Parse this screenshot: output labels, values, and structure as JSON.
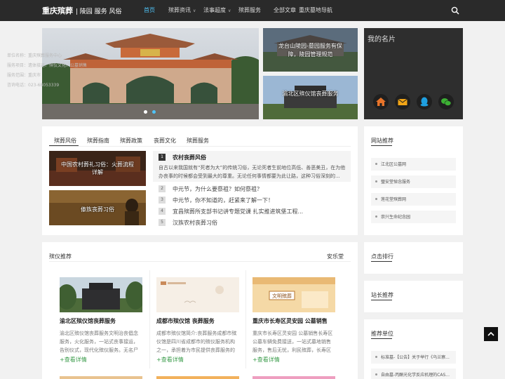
{
  "header": {
    "logo": "重庆殡葬",
    "logo_sub": "| 陵园 服务 风俗",
    "nav": [
      {
        "label": "首页",
        "active": true,
        "caret": false
      },
      {
        "label": "殡葬资讯",
        "active": false,
        "caret": true
      },
      {
        "label": "法事超度",
        "active": false,
        "caret": true
      },
      {
        "label": "殡葬服务",
        "active": false,
        "caret": false
      },
      {
        "label": "全部文章",
        "active": false,
        "caret": false
      },
      {
        "label": "重庆墓地导航",
        "active": false,
        "caret": false
      }
    ],
    "search_icon": "search-icon"
  },
  "banner": {
    "thumbs": [
      {
        "caption_line1": "龙台山陵园-墓园服务有保",
        "caption_line2": "障，陵园管理规范"
      },
      {
        "caption_line1": "渝北区殡仪馆丧葬服务",
        "caption_line2": ""
      }
    ]
  },
  "namecard": {
    "title": "我的名片",
    "lines": [
      "单位名称：重庆殡葬服务中心",
      "服务项目：遗体接运、殡仪文化、公墓销售",
      "服务范围：重庆市",
      "咨询电话：023-68053339"
    ],
    "icons": [
      "home-icon",
      "mail-icon",
      "qq-icon",
      "wechat-icon"
    ],
    "colors": {
      "home": "#e8742a",
      "mail": "#f2a516",
      "qq": "#1e9fe0",
      "wechat": "#3cb034"
    }
  },
  "news": {
    "tabs": [
      "殡葬风俗",
      "殡葬指南",
      "殡葬政策",
      "丧葬文化",
      "殡葬服务"
    ],
    "images": [
      {
        "caption_line1": "中国农村葬礼习俗：火葬流程",
        "caption_line2": "详解"
      },
      {
        "caption_line1": "傣族丧葬习俗",
        "caption_line2": ""
      }
    ],
    "highlight": {
      "num": "1",
      "title": "农村丧葬风俗",
      "text": "自古以来我国就有“死者为大”的传统习俗，无论死者生前地位高低、善恶美丑，在为他办丧事的时候都会受到最大的尊重。无论任何事情都要为此让路，这种习俗深刻的..."
    },
    "items": [
      {
        "num": "2",
        "title": "中元节，为什么要祭祖？如何祭祖？"
      },
      {
        "num": "3",
        "title": "中元节，你不知道的，赶紧来了解一下！"
      },
      {
        "num": "4",
        "title": "宜昌殡葬所支部书记讲专题党课 扎实推进筑堡工程..."
      },
      {
        "num": "5",
        "title": "汉族农村丧葬习俗"
      }
    ]
  },
  "sidebar": {
    "recommend_title": "网站推荐",
    "recommend_items": [
      "江北区公墓网",
      "璧安堂悼念服务",
      "莲花堂殡葬网",
      "崇兴生命纪念园"
    ],
    "click_title": "点击排行",
    "webmaster_title": "站长推荐",
    "units_title": "推荐单位",
    "units_items": [
      "标准墓-【公告】关于举行《乌兰察...",
      "自由墓-丙酮光化学反应机理的CAS..."
    ]
  },
  "products": {
    "title": "殡仪推荐",
    "right_label": "安乐堂",
    "cards": [
      {
        "title": "渝北区殡仪馆丧葬服务",
        "desc": "渝北区殡仪馆丧葬服务文明治丧倡念服务，火化服务，一站式丧事接运，告别仪式，现代化殡仪服务。无名尸",
        "more": "+查看详情"
      },
      {
        "title": "成都市殡仪馆 丧葬服务",
        "desc": "成都市殡仪馆简介:丧葬服务成都市殡仪馆是四川省成都市的殡仪服务机构之一，承担着为市民提供丧葬服务的",
        "more": "+查看详情"
      },
      {
        "title": "重庆市长寿区灵安园 公墓销售",
        "desc": "重庆市长寿区灵安园 公墓销售长寿区公墓车辆免费接送，一站式墓地销售服务，售后无忧，利民殡葬，长寿区",
        "more": "+查看详情"
      }
    ],
    "civ_label": "文明殡葬"
  },
  "totop_icon": "back-to-top-icon"
}
